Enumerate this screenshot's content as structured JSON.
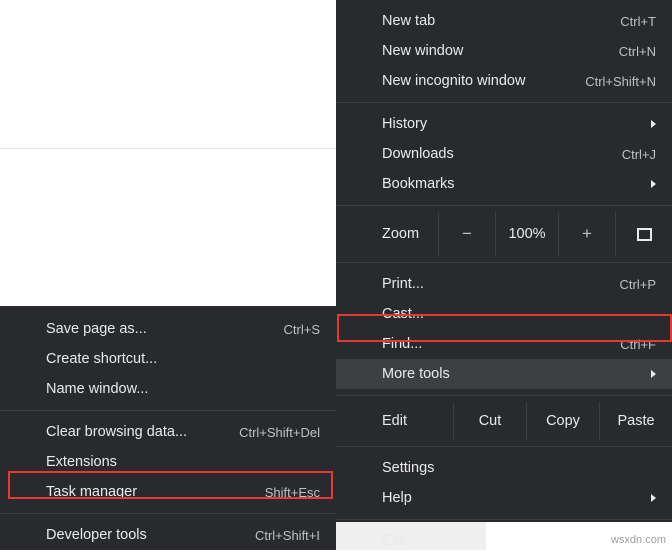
{
  "main_menu": {
    "items": [
      {
        "label": "New tab",
        "accel": "Ctrl+T",
        "submenu": false
      },
      {
        "label": "New window",
        "accel": "Ctrl+N",
        "submenu": false
      },
      {
        "label": "New incognito window",
        "accel": "Ctrl+Shift+N",
        "submenu": false
      }
    ],
    "nav_items": [
      {
        "label": "History",
        "accel": "",
        "submenu": true
      },
      {
        "label": "Downloads",
        "accel": "Ctrl+J",
        "submenu": false
      },
      {
        "label": "Bookmarks",
        "accel": "",
        "submenu": true
      }
    ],
    "zoom": {
      "label": "Zoom",
      "minus": "−",
      "percent": "100%",
      "plus": "+",
      "fullscreen_icon": "fullscreen-icon"
    },
    "tool_items": [
      {
        "label": "Print...",
        "accel": "Ctrl+P",
        "submenu": false
      },
      {
        "label": "Cast...",
        "accel": "",
        "submenu": false
      },
      {
        "label": "Find...",
        "accel": "Ctrl+F",
        "submenu": false
      }
    ],
    "more_tools": {
      "label": "More tools",
      "accel": "",
      "submenu": true
    },
    "edit": {
      "label": "Edit",
      "cut": "Cut",
      "copy": "Copy",
      "paste": "Paste"
    },
    "settings_items": [
      {
        "label": "Settings",
        "accel": "",
        "submenu": false
      },
      {
        "label": "Help",
        "accel": "",
        "submenu": true
      }
    ],
    "exit": {
      "label": "Exit",
      "accel": "",
      "submenu": false
    }
  },
  "submenu": {
    "group1": [
      {
        "label": "Save page as...",
        "accel": "Ctrl+S"
      },
      {
        "label": "Create shortcut...",
        "accel": ""
      },
      {
        "label": "Name window...",
        "accel": ""
      }
    ],
    "group2": [
      {
        "label": "Clear browsing data...",
        "accel": "Ctrl+Shift+Del"
      },
      {
        "label": "Extensions",
        "accel": ""
      },
      {
        "label": "Task manager",
        "accel": "Shift+Esc"
      }
    ],
    "group3": [
      {
        "label": "Developer tools",
        "accel": "Ctrl+Shift+I"
      }
    ]
  },
  "watermark": "wsxdn.com",
  "colors": {
    "menu_bg": "#292a2d",
    "text": "#e8eaed",
    "accel": "#bdc1c6",
    "separator": "#3c4043",
    "highlight": "#3c4043",
    "annotation_red": "#e53935"
  }
}
